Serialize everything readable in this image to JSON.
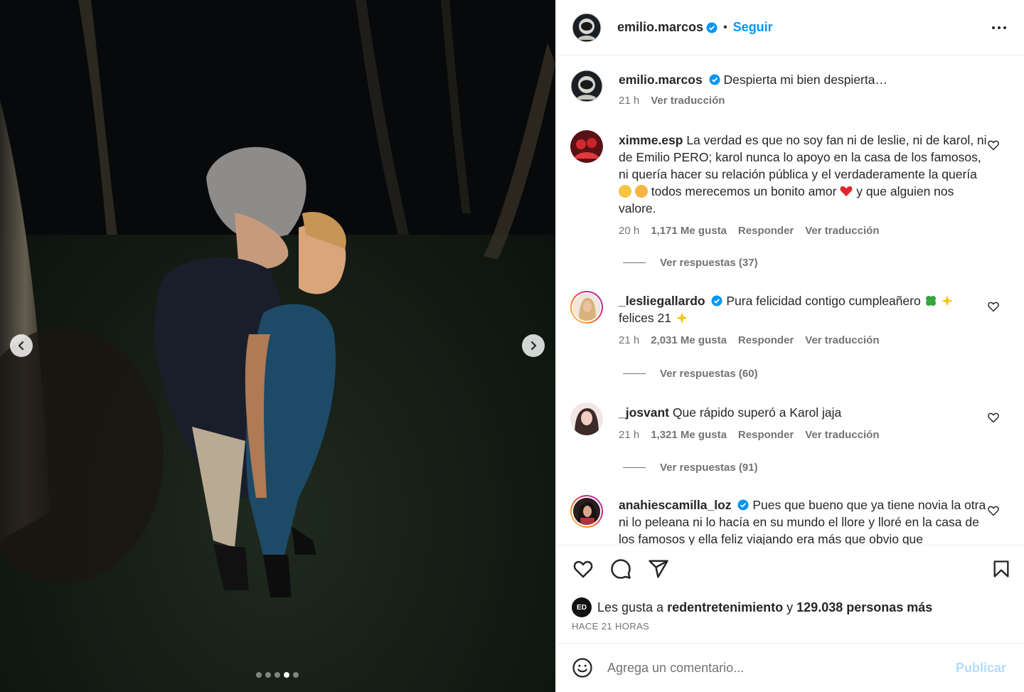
{
  "post": {
    "author": "emilio.marcos",
    "separator": "•",
    "follow_label": "Seguir",
    "caption": "Despierta mi bien despierta…",
    "caption_age": "21 h",
    "caption_translate": "Ver traducción",
    "carousel": {
      "slide_count": 5,
      "active_slide": 4
    }
  },
  "comments": [
    {
      "user": "ximme.esp",
      "verified": false,
      "text_parts": [
        "La verdad es que no soy fan ni de leslie, ni de karol, ni de Emilio PERO; karol nunca lo apoyo en la casa de los famosos, ni quería hacer su relación pública y el verdaderamente la quería",
        "todos merecemos un bonito amor",
        "y que alguien nos valore."
      ],
      "age": "20 h",
      "likes": "1,171 Me gusta",
      "reply": "Responder",
      "translate": "Ver traducción",
      "replies": "Ver respuestas (37)"
    },
    {
      "user": "_lesliegallardo",
      "verified": true,
      "text_parts": [
        "Pura felicidad contigo cumpleañero",
        "felices 21"
      ],
      "age": "21 h",
      "likes": "2,031 Me gusta",
      "reply": "Responder",
      "translate": "Ver traducción",
      "replies": "Ver respuestas (60)"
    },
    {
      "user": "_josvant",
      "verified": false,
      "text_parts": [
        "Que rápido superó a Karol jaja"
      ],
      "age": "21 h",
      "likes": "1,321 Me gusta",
      "reply": "Responder",
      "translate": "Ver traducción",
      "replies": "Ver respuestas (91)"
    },
    {
      "user": "anahiescamilla_loz",
      "verified": true,
      "text_parts": [
        "Pues que bueno que ya tiene novia la otra ni lo peleana ni lo hacía en su mundo el llore y lloré en la casa de los famosos y ella feliz viajando era más que obvio que"
      ]
    }
  ],
  "likes_bar": {
    "prefix": "Les gusta a",
    "liker": "redentretenimiento",
    "joiner": "y",
    "others": "129.038 personas más",
    "liker_badge": "ED"
  },
  "timestamp": "HACE 21 HORAS",
  "composer": {
    "placeholder": "Agrega un comentario...",
    "publish_label": "Publicar"
  },
  "icons": [
    "chevron-left-icon",
    "chevron-right-icon",
    "more-icon",
    "verified-badge-icon",
    "heart-icon",
    "comment-icon",
    "share-icon",
    "bookmark-icon",
    "emoji-icon"
  ],
  "colors": {
    "link_blue": "#0095f6",
    "publish_disabled": "#b3dbff",
    "verified_blue": "#0095f6",
    "muted_text": "#737373"
  }
}
